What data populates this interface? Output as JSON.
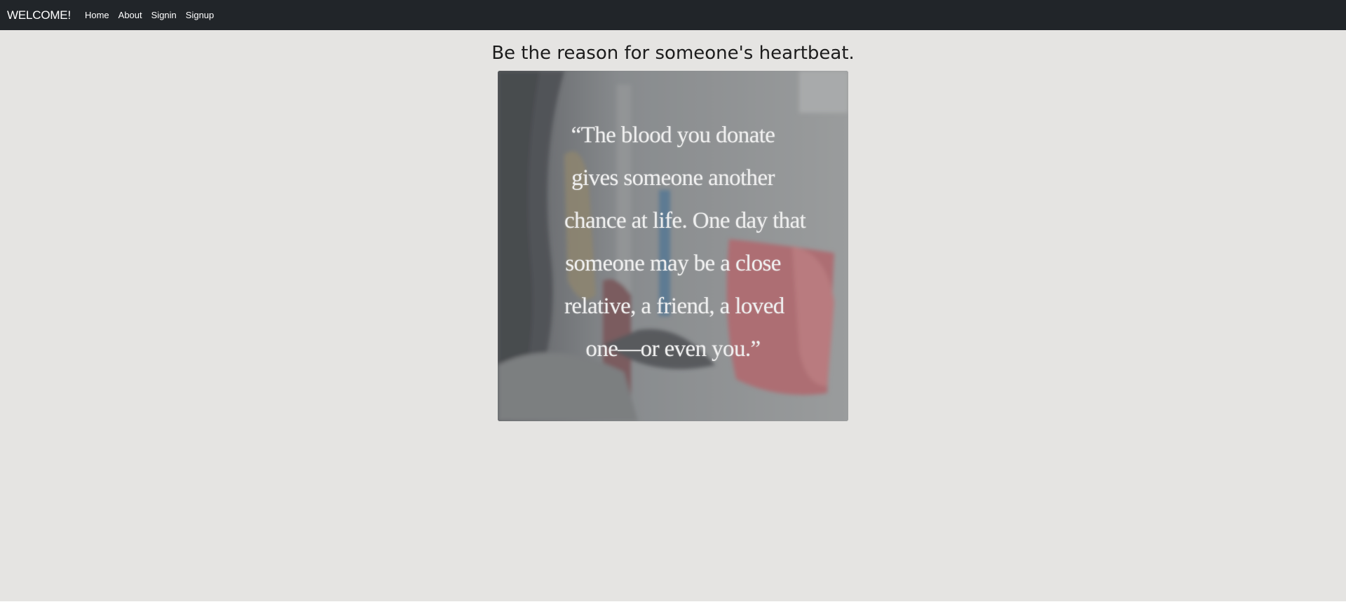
{
  "navbar": {
    "brand": "WELCOME!",
    "links": [
      "Home",
      "About",
      "Signin",
      "Signup"
    ]
  },
  "main": {
    "headline": "Be the reason for someone's heartbeat.",
    "poster": {
      "quote_lines": [
        "“The blood you donate",
        "gives someone another",
        "chance at life. One day that",
        "someone may be a close",
        "relative, a friend, a loved",
        "one—or even you.”"
      ]
    }
  }
}
